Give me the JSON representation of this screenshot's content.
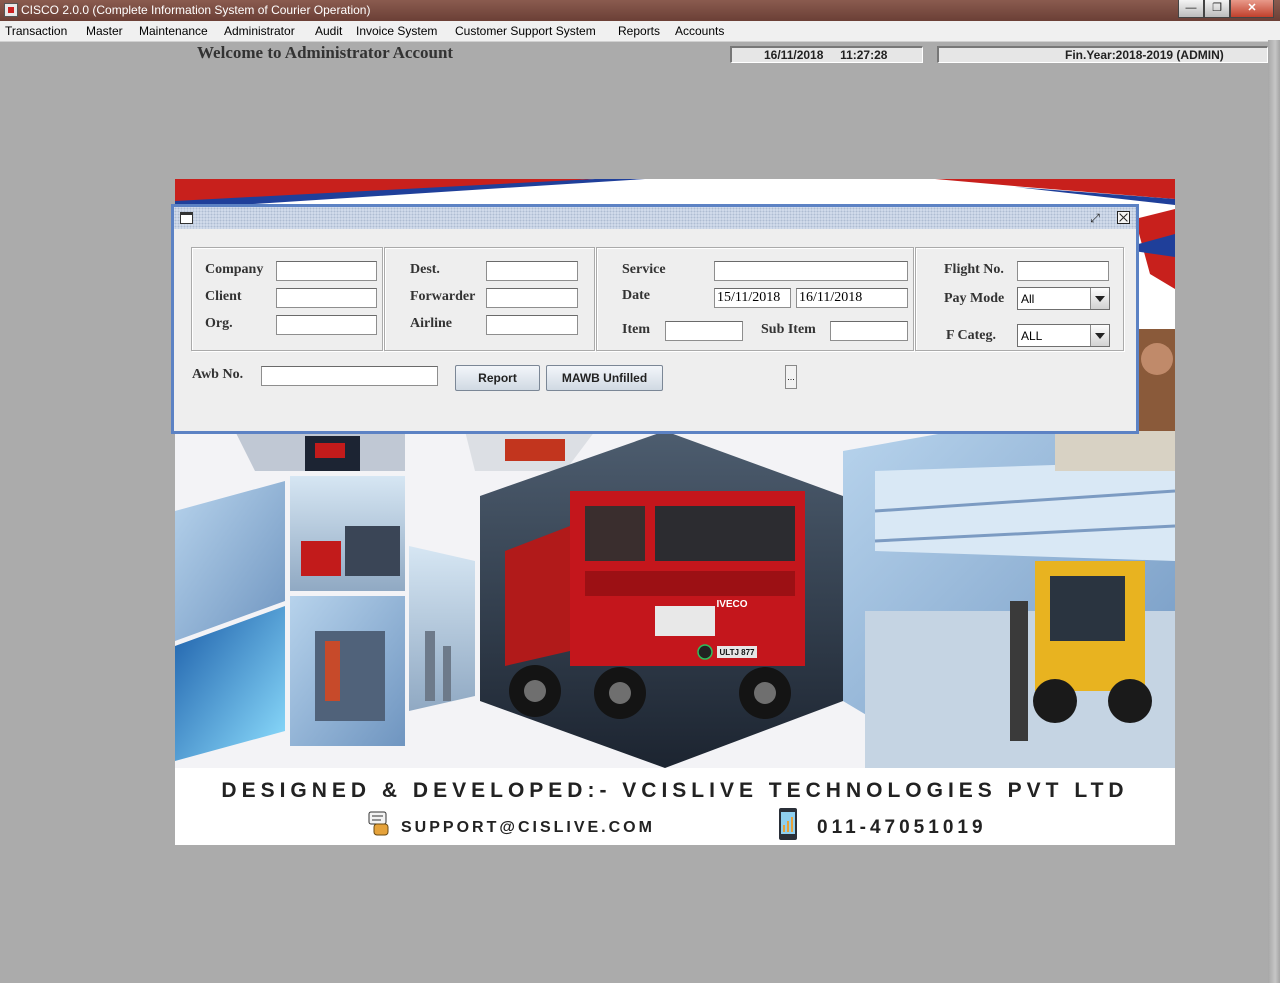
{
  "window": {
    "title": "CISCO 2.0.0 (Complete Information System of Courier Operation)",
    "minimize_label": "—",
    "maximize_label": "❐",
    "close_label": "✕"
  },
  "menu": {
    "items": [
      "Transaction",
      "Master",
      "Maintenance",
      "Administrator",
      "Audit",
      "Invoice System",
      "Customer Support System",
      "Reports",
      "Accounts"
    ]
  },
  "header": {
    "welcome": "Welcome to Administrator Account",
    "datetime": "16/11/2018     11:27:28",
    "fin_year": "Fin.Year:2018-2019  (ADMIN)"
  },
  "dialog": {
    "resize_label": "⤢",
    "labels": {
      "company": "Company",
      "client": "Client",
      "org": "Org.",
      "dest": "Dest.",
      "forwarder": "Forwarder",
      "airline": "Airline",
      "service": "Service",
      "date": "Date",
      "item": "Item",
      "sub_item": "Sub Item",
      "flight_no": "Flight No.",
      "pay_mode": "Pay Mode",
      "f_categ": "F Categ.",
      "awb_no": "Awb No."
    },
    "values": {
      "company": "",
      "client": "",
      "org": "",
      "dest": "",
      "forwarder": "",
      "airline": "",
      "service": "",
      "date_from": "15/11/2018",
      "date_to": "16/11/2018",
      "item": "",
      "sub_item": "",
      "flight_no": "",
      "awb_no": ""
    },
    "pay_mode_selected": "All",
    "f_categ_selected": "ALL",
    "buttons": {
      "report": "Report",
      "mawb_unfilled": "MAWB Unfilled",
      "small": "..."
    }
  },
  "banner": {
    "designed_by": "DESIGNED & DEVELOPED:- VCISLIVE TECHNOLOGIES PVT LTD",
    "email": "SUPPORT@CISLIVE.COM",
    "phone": "011-47051019",
    "truck_badge": "IVECO",
    "truck_plate": "ULTJ 877",
    "colors": {
      "stripe_red": "#c8201c",
      "stripe_blue": "#1f3f9a",
      "truck_red": "#c4161c",
      "forklift_yellow": "#e8b320"
    }
  }
}
